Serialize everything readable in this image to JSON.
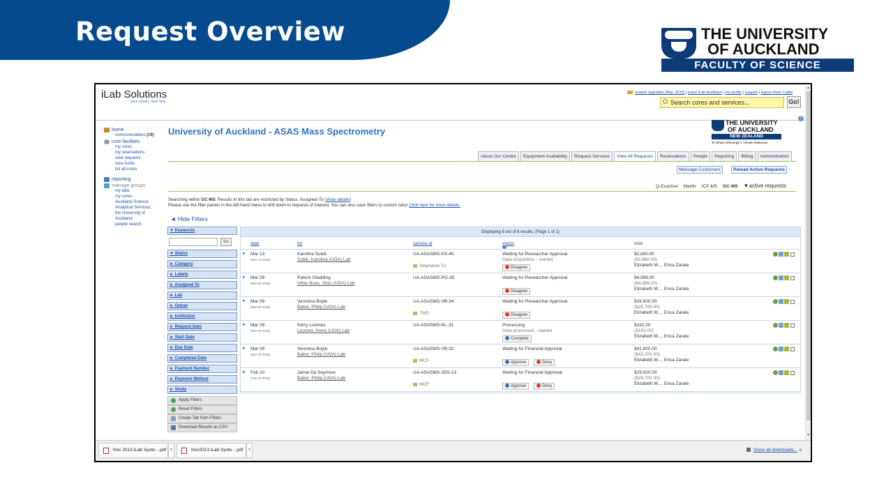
{
  "slide": {
    "title": "Request Overview",
    "uoa_line1": "THE UNIVERSITY",
    "uoa_line2": "OF AUCKLAND",
    "faculty": "FACULTY OF SCIENCE"
  },
  "ilab": {
    "logo": "iLab Solutions",
    "slogan": "save money, save time",
    "top_links": [
      "system upgrades (Mar, 2015)",
      "leave iLab feedback",
      "my profile",
      "support",
      "logout Peter Cattle"
    ],
    "search_placeholder": "Search cores and services...",
    "search_button": "Go!"
  },
  "leftnav": {
    "home": "home",
    "communications": "communications",
    "communications_count": "(19)",
    "core_facilities": "core facilities",
    "core_items": [
      "my cores",
      "my reservations",
      "view requests",
      "view funds",
      "list all cores"
    ],
    "reporting": "reporting",
    "manage_groups": "manage groups",
    "group_items": [
      "my labs",
      "my cores",
      "Auckland Science",
      "Analytical Services,",
      "the University of",
      "Auckland",
      "people search"
    ]
  },
  "core": {
    "title": "University of Auckland - ASAS Mass Spectrometry",
    "logo_line1": "THE UNIVERSITY",
    "logo_line2": "OF AUCKLAND",
    "logo_nz": "NEW ZEALAND",
    "logo_maori": "Te Whare Wānanga o Tāmaki Makaurau",
    "tabs": [
      "About Our Centre",
      "Equipment Availability",
      "Request Services",
      "View All Requests",
      "Reservations",
      "People",
      "Reporting",
      "Billing",
      "Administration"
    ],
    "active_tab": "View All Requests",
    "message_customers": "Message Customers",
    "reload_active": "Reload Active Requests",
    "subtabs": [
      "Q-Exactive",
      "Martin",
      "ICP-MS",
      "GC-MS"
    ],
    "active_subtab": "GC-MS",
    "active_requests": "▼active requests"
  },
  "info": {
    "line1_a": "Searching within ",
    "line1_b": "GC-MS",
    "line1_c": ": Results in this tab are restricted by ",
    "line1_d": "Status, Assigned To",
    "line1_e": " (",
    "line1_link": "show details",
    "line1_f": ")",
    "line2": "Please use the filter panels in the left-hand menu to drill down to requests of interest. You can also save filters to custom tabs! ",
    "line2_link": "Click here for more details."
  },
  "filters": {
    "hide_label": "◄ Hide Filters",
    "keywords": "▼ Keywords",
    "go": "Go",
    "items": [
      "▼ Status",
      "► Category",
      "► Labels",
      "► Assigned To",
      "► Lab",
      "► Owner",
      "► Institution",
      "► Request Date",
      "► Start Date",
      "► Due Date",
      "► Completed Date",
      "► Payment Number",
      "► Payment Method",
      "► Study"
    ],
    "actions": [
      "Apply Filters",
      "Reset Filters",
      "Create Tab from Filters",
      "Download Results as CSV"
    ]
  },
  "results": {
    "summary": "Displaying 6 out of 6 results. (Page 1 of 1)",
    "columns": {
      "date": "date",
      "for": "for",
      "service_id": "service id",
      "status": "status",
      "cost": "cost"
    },
    "rows": [
      {
        "date": "Mar 13",
        "date_sub": "(Mar 13 2015)",
        "name": "Karolina Sulek",
        "lab": "Sulek, Karolina (UOA) Lab",
        "service_id": "UA-ASASMS-KS-45",
        "tag": "Stephanie Tu",
        "status": "Waiting for Researcher Approval",
        "status_sub": "Data Acquisition - started",
        "buttons": [
          "Disagree"
        ],
        "cost": "$2,860.00",
        "cost_sub": "($2,860.00)",
        "assignees": "Elizabeth M..., Erica Zarate"
      },
      {
        "date": "Mar 09",
        "date_sub": "(Mar 09 2015)",
        "name": "Patrick Gladding",
        "lab": "Villas Boas, Silas (UOA) Lab",
        "service_id": "UA-ASASMS-PG-35",
        "tag": "",
        "status": "Waiting for Researcher Approval",
        "status_sub": "",
        "buttons": [
          "Disagree"
        ],
        "cost": "$4,988.00",
        "cost_sub": "($4,988.00)",
        "assignees": "Elizabeth M..., Erica Zarate"
      },
      {
        "date": "Mar 09",
        "date_sub": "(Mar 09 2015)",
        "name": "Veronica Boyle",
        "lab": "Baker, Philip (UOA) Lab",
        "service_id": "UA-ASASMS-VB-34",
        "tag": "TMS",
        "status": "Waiting for Researcher Approval",
        "status_sub": "",
        "buttons": [
          "Disagree"
        ],
        "cost": "$28,600.00",
        "cost_sub": "($29,700.00)",
        "assignees": "Elizabeth M..., Erica Zarate"
      },
      {
        "date": "Mar 09",
        "date_sub": "(Mar 09 2015)",
        "name": "Kerry Loomes",
        "lab": "Loomes, Kerry (UOA) Lab",
        "service_id": "UA-ASASMS-KL-33",
        "tag": "",
        "status": "Processing",
        "status_sub": "Data processed - started",
        "buttons": [
          "Complete"
        ],
        "cost": "$162.00",
        "cost_sub": "($162.00)",
        "assignees": "Elizabeth M..., Erica Zarate"
      },
      {
        "date": "Mar 09",
        "date_sub": "(Mar 09 2015)",
        "name": "Veronica Boyle",
        "lab": "Baker, Philip (UOA) Lab",
        "service_id": "UA-ASASMS-VB-32",
        "tag": "MCF",
        "status": "Waiting for Financial Approval",
        "status_sub": "",
        "buttons": [
          "Approve",
          "Deny"
        ],
        "cost": "$41,600.00",
        "cost_sub": "($43,200.00)",
        "assignees": "Elizabeth M..., Erica Zarate"
      },
      {
        "date": "Feb 10",
        "date_sub": "(Feb 10 2015)",
        "name": "Jamie De Seymour",
        "lab": "Baker, Philip (UOA) Lab",
        "service_id": "UA-ASASMS-JDS-13",
        "tag": "MCF",
        "status": "Waiting for Financial Approval",
        "status_sub": "",
        "buttons": [
          "Approve",
          "Deny"
        ],
        "cost": "$29,920.00",
        "cost_sub": "($29,700.00)",
        "assignees": "Elizabeth M..., Erica Zarate"
      }
    ]
  },
  "downloads": {
    "items": [
      "Nov 2013 iLab Syste....pdf",
      "Nov2013 iLab Syste....pdf"
    ],
    "show_all": "Show all downloads...",
    "close": "×"
  },
  "colors": {
    "brand_blue": "#064a8e",
    "link_blue": "#1d4fa8",
    "accent_green": "#96c05b"
  }
}
